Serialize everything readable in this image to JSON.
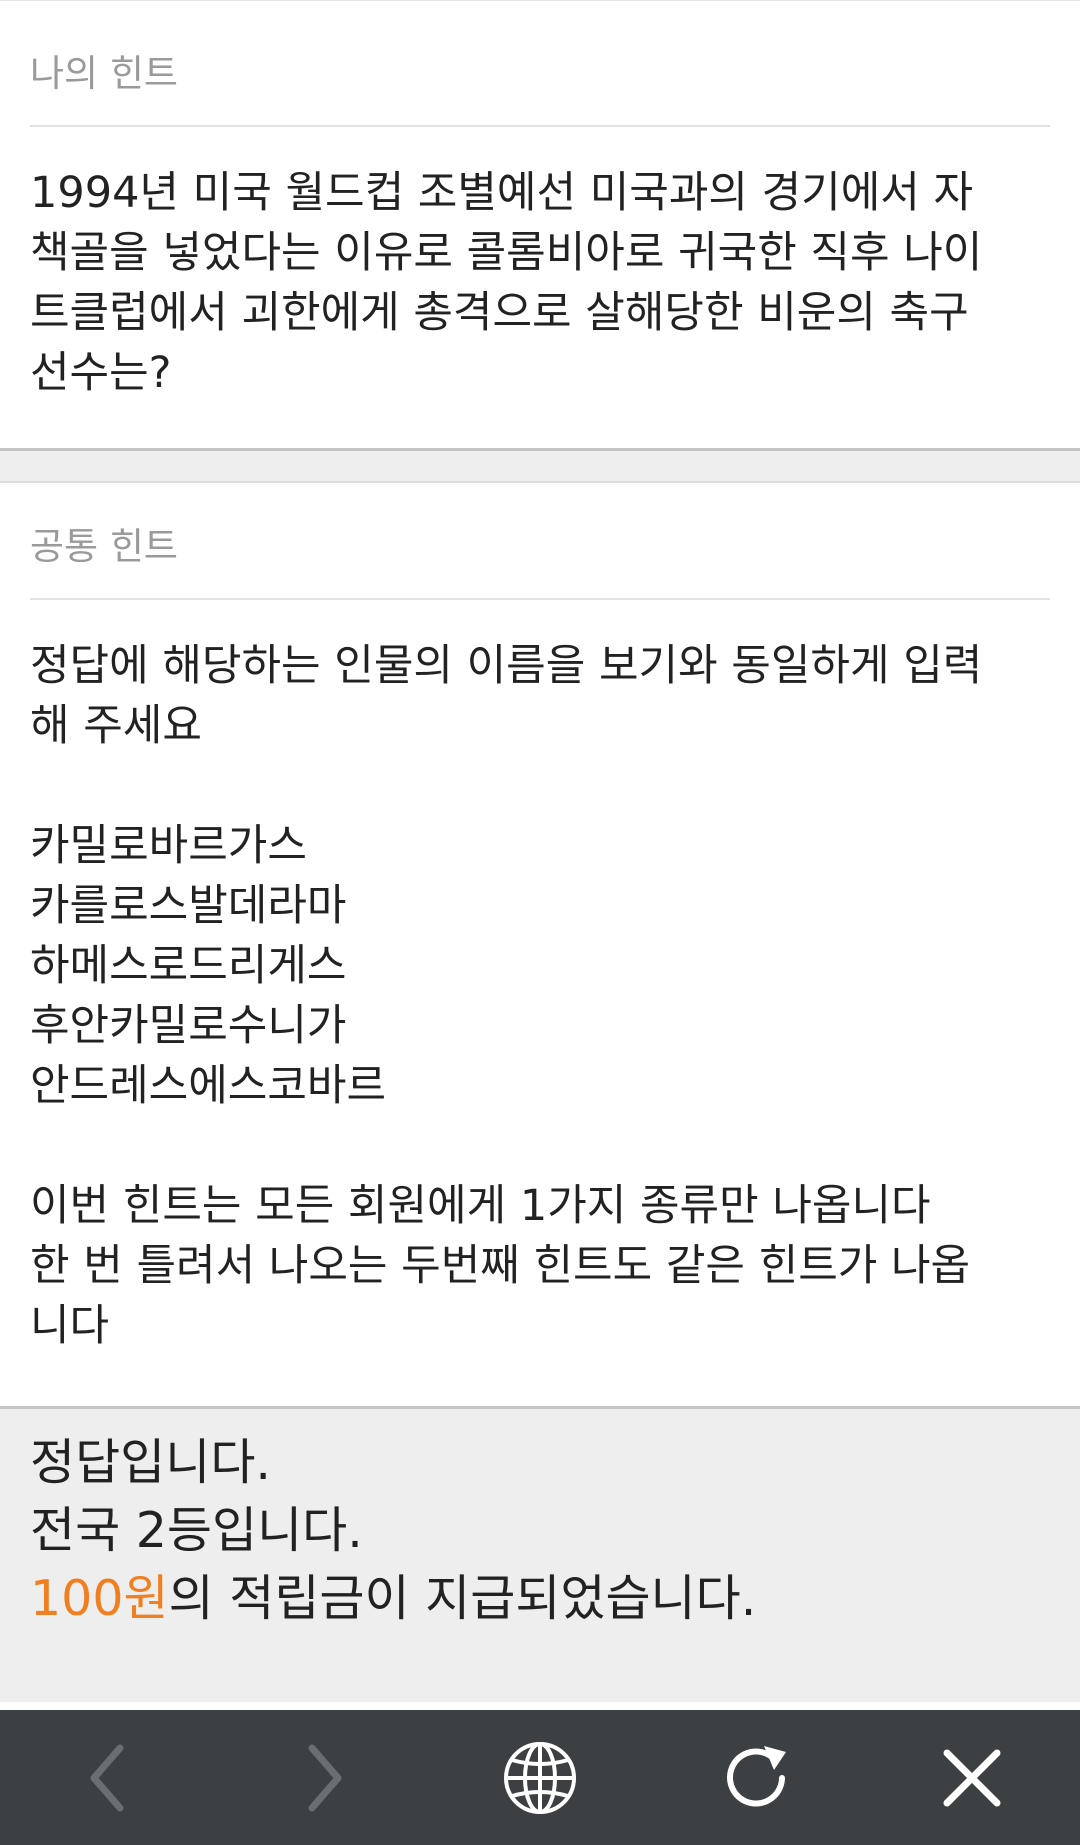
{
  "my_hint": {
    "title": "나의 힌트",
    "question_lines": [
      "1994년 미국 월드컵 조별예선 미국과의 경기에서 자",
      "책골을 넣었다는 이유로 콜롬비아로 귀국한 직후 나이",
      "트클럽에서 괴한에게 총격으로 살해당한 비운의 축구",
      "선수는?"
    ]
  },
  "common_hint": {
    "title": "공통 힌트",
    "instruction_lines": [
      "정답에 해당하는 인물의 이름을 보기와 동일하게 입력",
      "해 주세요"
    ],
    "options": [
      "카밀로바르가스",
      "카를로스발데라마",
      "하메스로드리게스",
      "후안카밀로수니가",
      "안드레스에스코바르"
    ],
    "note_lines": [
      "이번 힌트는 모든 회원에게 1가지 종류만 나옵니다",
      "한 번 틀려서 나오는 두번째 힌트도 같은 힌트가 나옵",
      "니다"
    ]
  },
  "result": {
    "line1": "정답입니다.",
    "line2": "전국 2등입니다.",
    "reward_amount": "100원",
    "reward_rest": "의 적립금이 지급되었습니다."
  },
  "nav": {
    "back_icon": "chevron-left-icon",
    "forward_icon": "chevron-right-icon",
    "globe_icon": "globe-icon",
    "refresh_icon": "refresh-icon",
    "close_icon": "close-icon"
  },
  "colors": {
    "accent": "#f07f22",
    "nav_background": "#3c4042",
    "nav_icon": "#ffffff",
    "nav_icon_disabled": "#6a6e70",
    "panel_background": "#eeeeee"
  }
}
